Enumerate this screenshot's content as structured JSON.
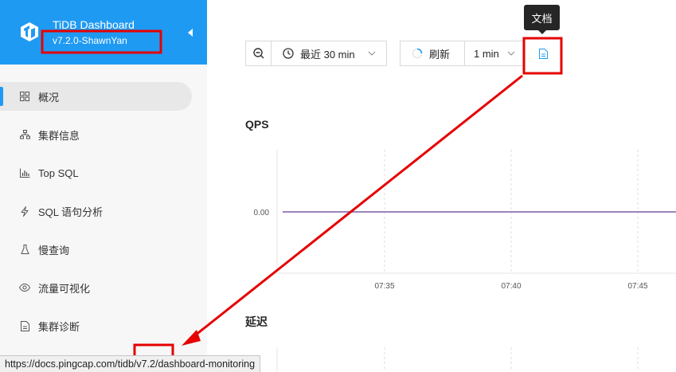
{
  "brand": {
    "title": "TiDB Dashboard",
    "version": "v7.2.0-ShawnYan"
  },
  "nav": [
    {
      "label": "概况",
      "icon": "grid-icon",
      "active": true
    },
    {
      "label": "集群信息",
      "icon": "cluster-icon"
    },
    {
      "label": "Top SQL",
      "icon": "bar-chart-icon"
    },
    {
      "label": "SQL 语句分析",
      "icon": "lightning-icon"
    },
    {
      "label": "慢查询",
      "icon": "flask-icon"
    },
    {
      "label": "流量可视化",
      "icon": "eye-icon"
    },
    {
      "label": "集群诊断",
      "icon": "document-icon"
    }
  ],
  "toolbar": {
    "time_range": "最近 30 min",
    "refresh_label": "刷新",
    "interval": "1 min",
    "docs_tooltip": "文档"
  },
  "charts": [
    {
      "title": "QPS"
    },
    {
      "title": "延迟"
    }
  ],
  "chart_data": {
    "type": "line",
    "title": "QPS",
    "x": [
      "07:35",
      "07:40",
      "07:45"
    ],
    "y_ticks": [
      "0.00"
    ],
    "series": [
      {
        "values": [
          0,
          0,
          0
        ]
      }
    ],
    "grid": true,
    "line_color": "#7b5ba6"
  },
  "statusbar": {
    "url": "https://docs.pingcap.com/tidb/v7.2/dashboard-monitoring"
  },
  "annotation_color": "#e60000"
}
